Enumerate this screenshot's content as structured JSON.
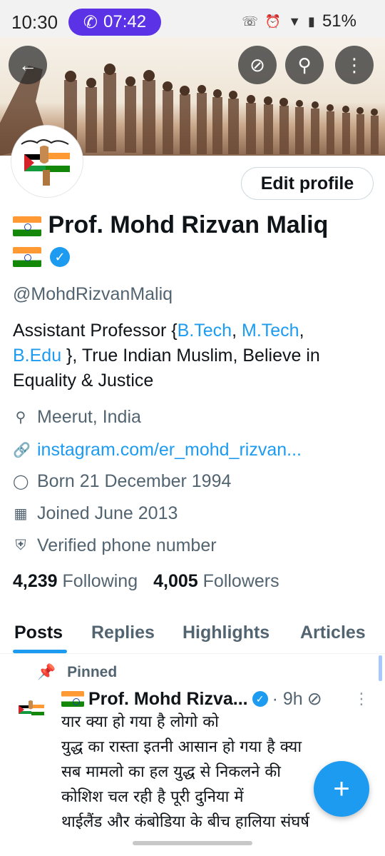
{
  "status_bar": {
    "time": "10:30",
    "call_timer": "07:42",
    "battery": "51%"
  },
  "profile": {
    "edit_button": "Edit profile",
    "name": "Prof. Mohd Rizvan Maliq",
    "handle": "@MohdRizvanMaliq",
    "bio": {
      "part1": "Assistant Professor {",
      "link1": "B.Tech",
      "sep1": ", ",
      "link2": "M.Tech",
      "sep2": ", ",
      "link3": "B.Edu",
      "part2": " }, True Indian Muslim, Believe in Equality & Justice"
    },
    "location": "Meerut, India",
    "website": "instagram.com/er_mohd_rizvan...",
    "birthday": "Born 21 December 1994",
    "joined": "Joined June 2013",
    "verified_phone": "Verified phone number",
    "following_count": "4,239",
    "following_label": "Following",
    "followers_count": "4,005",
    "followers_label": "Followers"
  },
  "tabs": [
    "Posts",
    "Replies",
    "Highlights",
    "Articles"
  ],
  "pinned_post": {
    "pinned_label": "Pinned",
    "author": "Prof. Mohd Rizva...",
    "time": "· 9h",
    "lines": [
      "यार क्या हो गया है लोगो को",
      "युद्ध का रास्ता इतनी आसान हो गया है क्या",
      "सब मामलो का हल युद्ध से निकलने की",
      "कोशिश चल रही है पूरी दुनिया में",
      "थाईलैंड और कंबोडिया के बीच हालिया संघर्ष"
    ]
  },
  "icons": {
    "back": "arrow-left-icon",
    "grok": "slash-circle-icon",
    "search": "search-icon",
    "more": "more-vertical-icon",
    "location": "location-pin-icon",
    "link": "link-icon",
    "birthday": "balloon-icon",
    "calendar": "calendar-icon",
    "shield": "shield-check-icon",
    "pin": "pin-icon",
    "compose": "plus-icon"
  },
  "colors": {
    "accent": "#1d9bf0",
    "call_pill": "#5b32e6"
  }
}
